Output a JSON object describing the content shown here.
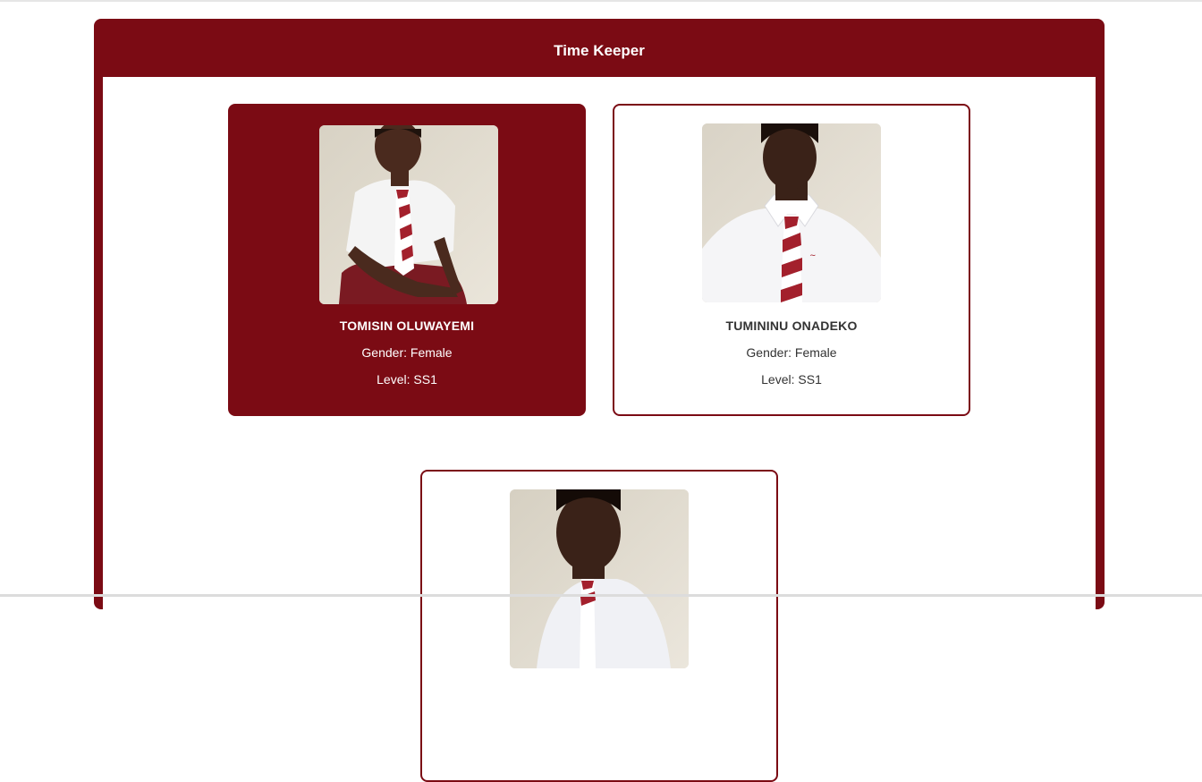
{
  "header": {
    "title": "Time Keeper"
  },
  "cards": [
    {
      "name": "TOMISIN OLUWAYEMI",
      "gender_label": "Gender:",
      "gender": "Female",
      "level_label": "Level:",
      "level": "SS1",
      "active": true
    },
    {
      "name": "TUMININU ONADEKO",
      "gender_label": "Gender:",
      "gender": "Female",
      "level_label": "Level:",
      "level": "SS1",
      "active": false
    },
    {
      "name": "",
      "gender_label": "",
      "gender": "",
      "level_label": "",
      "level": "",
      "active": false
    }
  ],
  "colors": {
    "brand": "#7b0b14",
    "background": "#ffffff",
    "text": "#333333"
  }
}
